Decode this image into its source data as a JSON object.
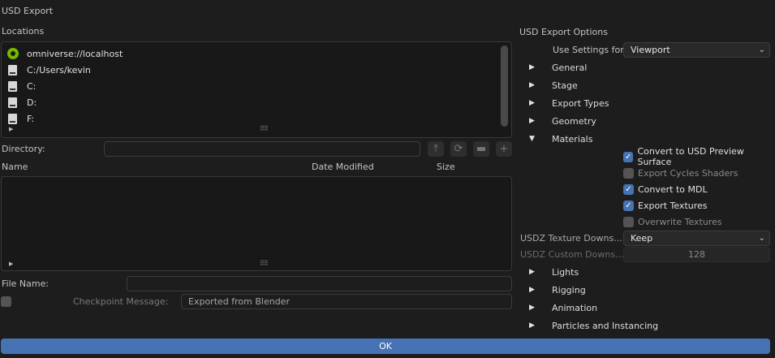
{
  "title": "USD Export",
  "locations": {
    "label": "Locations",
    "items": [
      {
        "label": "omniverse://localhost",
        "icon": "omniverse-icon"
      },
      {
        "label": "C:/Users/kevin",
        "icon": "drive-icon"
      },
      {
        "label": "C:",
        "icon": "drive-icon"
      },
      {
        "label": "D:",
        "icon": "drive-icon"
      },
      {
        "label": "F:",
        "icon": "drive-icon"
      }
    ]
  },
  "directory": {
    "label": "Directory:",
    "value": ""
  },
  "columns": {
    "name": "Name",
    "date": "Date Modified",
    "size": "Size"
  },
  "file_name": {
    "label": "File Name:",
    "value": ""
  },
  "checkpoint": {
    "label": "Checkpoint Message:",
    "value": "Exported from Blender",
    "checked": false
  },
  "options": {
    "title": "USD Export Options",
    "use_settings_label": "Use Settings for",
    "use_settings_value": "Viewport",
    "sections_top": [
      "General",
      "Stage",
      "Export Types",
      "Geometry"
    ],
    "materials": "Materials",
    "checkboxes": [
      {
        "label": "Convert to USD Preview Surface",
        "checked": true
      },
      {
        "label": "Export Cycles Shaders",
        "checked": false
      },
      {
        "label": "Convert to MDL",
        "checked": true
      },
      {
        "label": "Export Textures",
        "checked": true
      },
      {
        "label": "Overwrite Textures",
        "checked": false
      }
    ],
    "usdz_texture_label": "USDZ Texture Downs...",
    "usdz_texture_value": "Keep",
    "usdz_custom_label": "USDZ Custom Downs...",
    "usdz_custom_value": "128",
    "sections_bottom": [
      "Lights",
      "Rigging",
      "Animation",
      "Particles and Instancing"
    ]
  },
  "ok_label": "OK",
  "accent": "#4772b3"
}
